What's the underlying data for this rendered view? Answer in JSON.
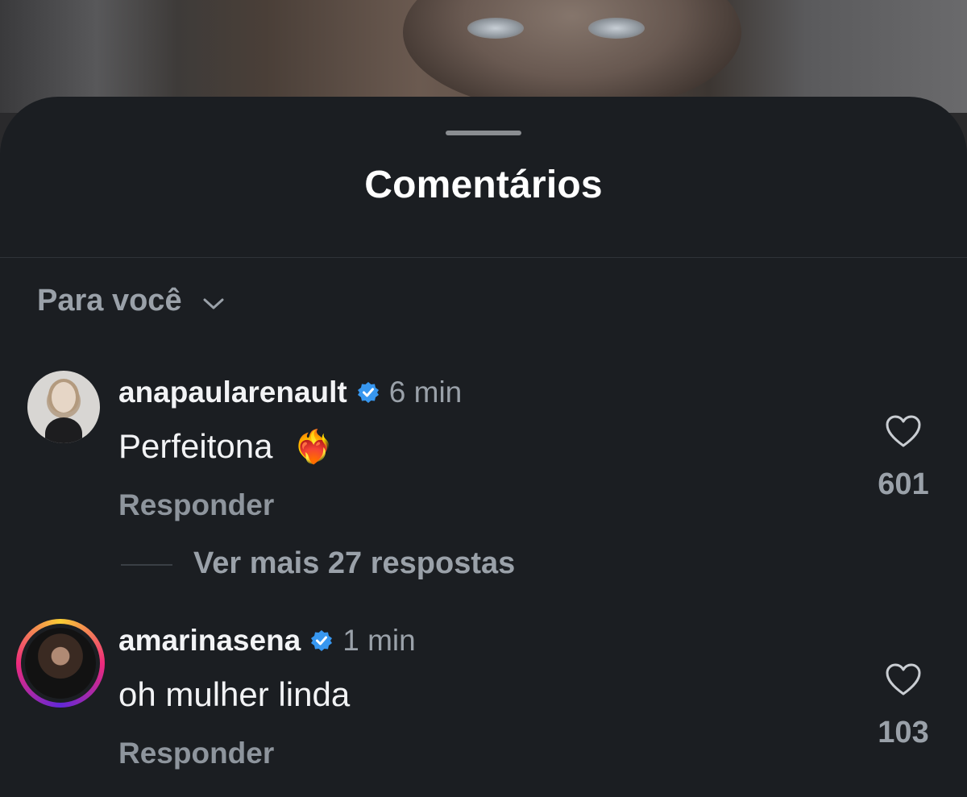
{
  "sheet": {
    "title": "Comentários"
  },
  "sort": {
    "label": "Para você",
    "icon": "chevron-down-icon"
  },
  "comments": [
    {
      "username": "anapaularenault",
      "verified": true,
      "time": "6 min",
      "text": "Perfeitona",
      "emoji": "❤️‍🔥",
      "reply_label": "Responder",
      "likes": "601",
      "more_replies": "Ver mais 27 respostas"
    },
    {
      "username": "amarinasena",
      "verified": true,
      "time": "1 min",
      "text": "oh mulher linda",
      "reply_label": "Responder",
      "likes": "103"
    }
  ],
  "colors": {
    "sheet_bg": "#1b1e22",
    "text_primary": "#f2f3f5",
    "text_secondary": "#9aa1a9",
    "verified_blue": "#3797f0"
  }
}
